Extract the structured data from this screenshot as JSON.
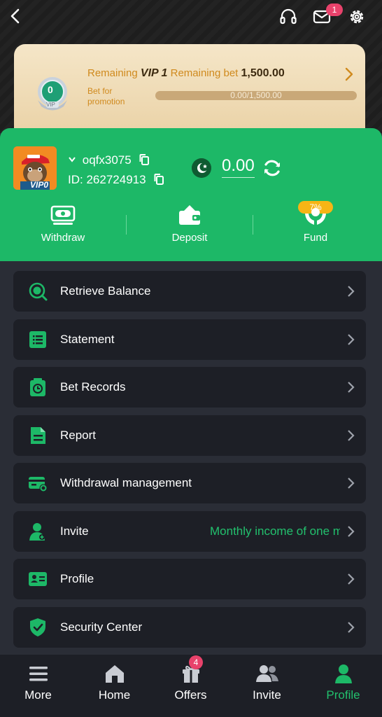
{
  "header": {
    "mail_badge": "1"
  },
  "vip": {
    "medal_level": "0",
    "medal_tag": "VIP",
    "remaining_prefix": "Remaining",
    "target_level": "VIP 1",
    "remaining_bet_label": "Remaining bet",
    "remaining_bet_amount": "1,500.00",
    "bet_for_promotion": "Bet for promotion",
    "progress_text": "0.00/1,500.00",
    "progress_fraction": 0
  },
  "user": {
    "username": "oqfx3075",
    "id_label": "ID:",
    "id_value": "262724913",
    "avatar_tag": "VIP0",
    "balance": "0.00"
  },
  "actions": [
    {
      "label": "Withdraw"
    },
    {
      "label": "Deposit"
    },
    {
      "label": "Fund",
      "badge": "7%"
    }
  ],
  "menu": [
    {
      "label": "Retrieve Balance"
    },
    {
      "label": "Statement"
    },
    {
      "label": "Bet Records"
    },
    {
      "label": "Report"
    },
    {
      "label": "Withdrawal management"
    },
    {
      "label": "Invite",
      "extra": "Monthly income of one m"
    },
    {
      "label": "Profile"
    },
    {
      "label": "Security Center"
    }
  ],
  "nav": [
    {
      "label": "More"
    },
    {
      "label": "Home"
    },
    {
      "label": "Offers",
      "badge": "4"
    },
    {
      "label": "Invite"
    },
    {
      "label": "Profile"
    }
  ],
  "colors": {
    "accent_green": "#1db867",
    "text_green": "#22c06d",
    "vip_gold": "#d08a1e",
    "badge_red": "#e8426b",
    "fund_badge": "#f7b515"
  }
}
